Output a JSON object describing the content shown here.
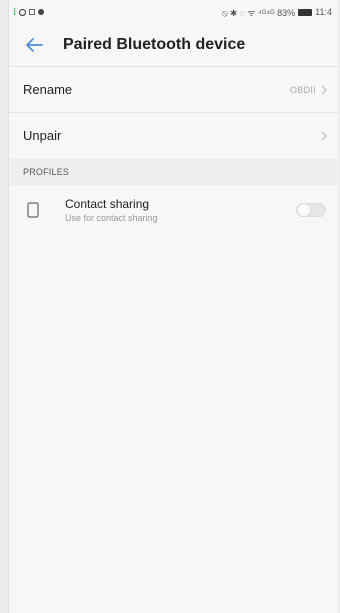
{
  "status_bar": {
    "right_text": "⦸ ✱ ○ ☉ ⁴ᴳ⸝⁴ᴳ⸝83% ",
    "time": "11:4"
  },
  "header": {
    "title": "Paired Bluetooth device"
  },
  "settings": {
    "rename_label": "Rename",
    "rename_value": "OBDII",
    "unpair_label": "Unpair"
  },
  "profiles": {
    "section_label": "PROFILES",
    "items": [
      {
        "title": "Contact sharing",
        "subtitle": "Use for contact sharing",
        "enabled": false
      }
    ]
  },
  "colors": {
    "accent": "#4a90d9",
    "background": "#f7f7f7"
  },
  "icons": {
    "back": "arrow-left",
    "chevron": "chevron-right",
    "profile": "phone-outline"
  }
}
